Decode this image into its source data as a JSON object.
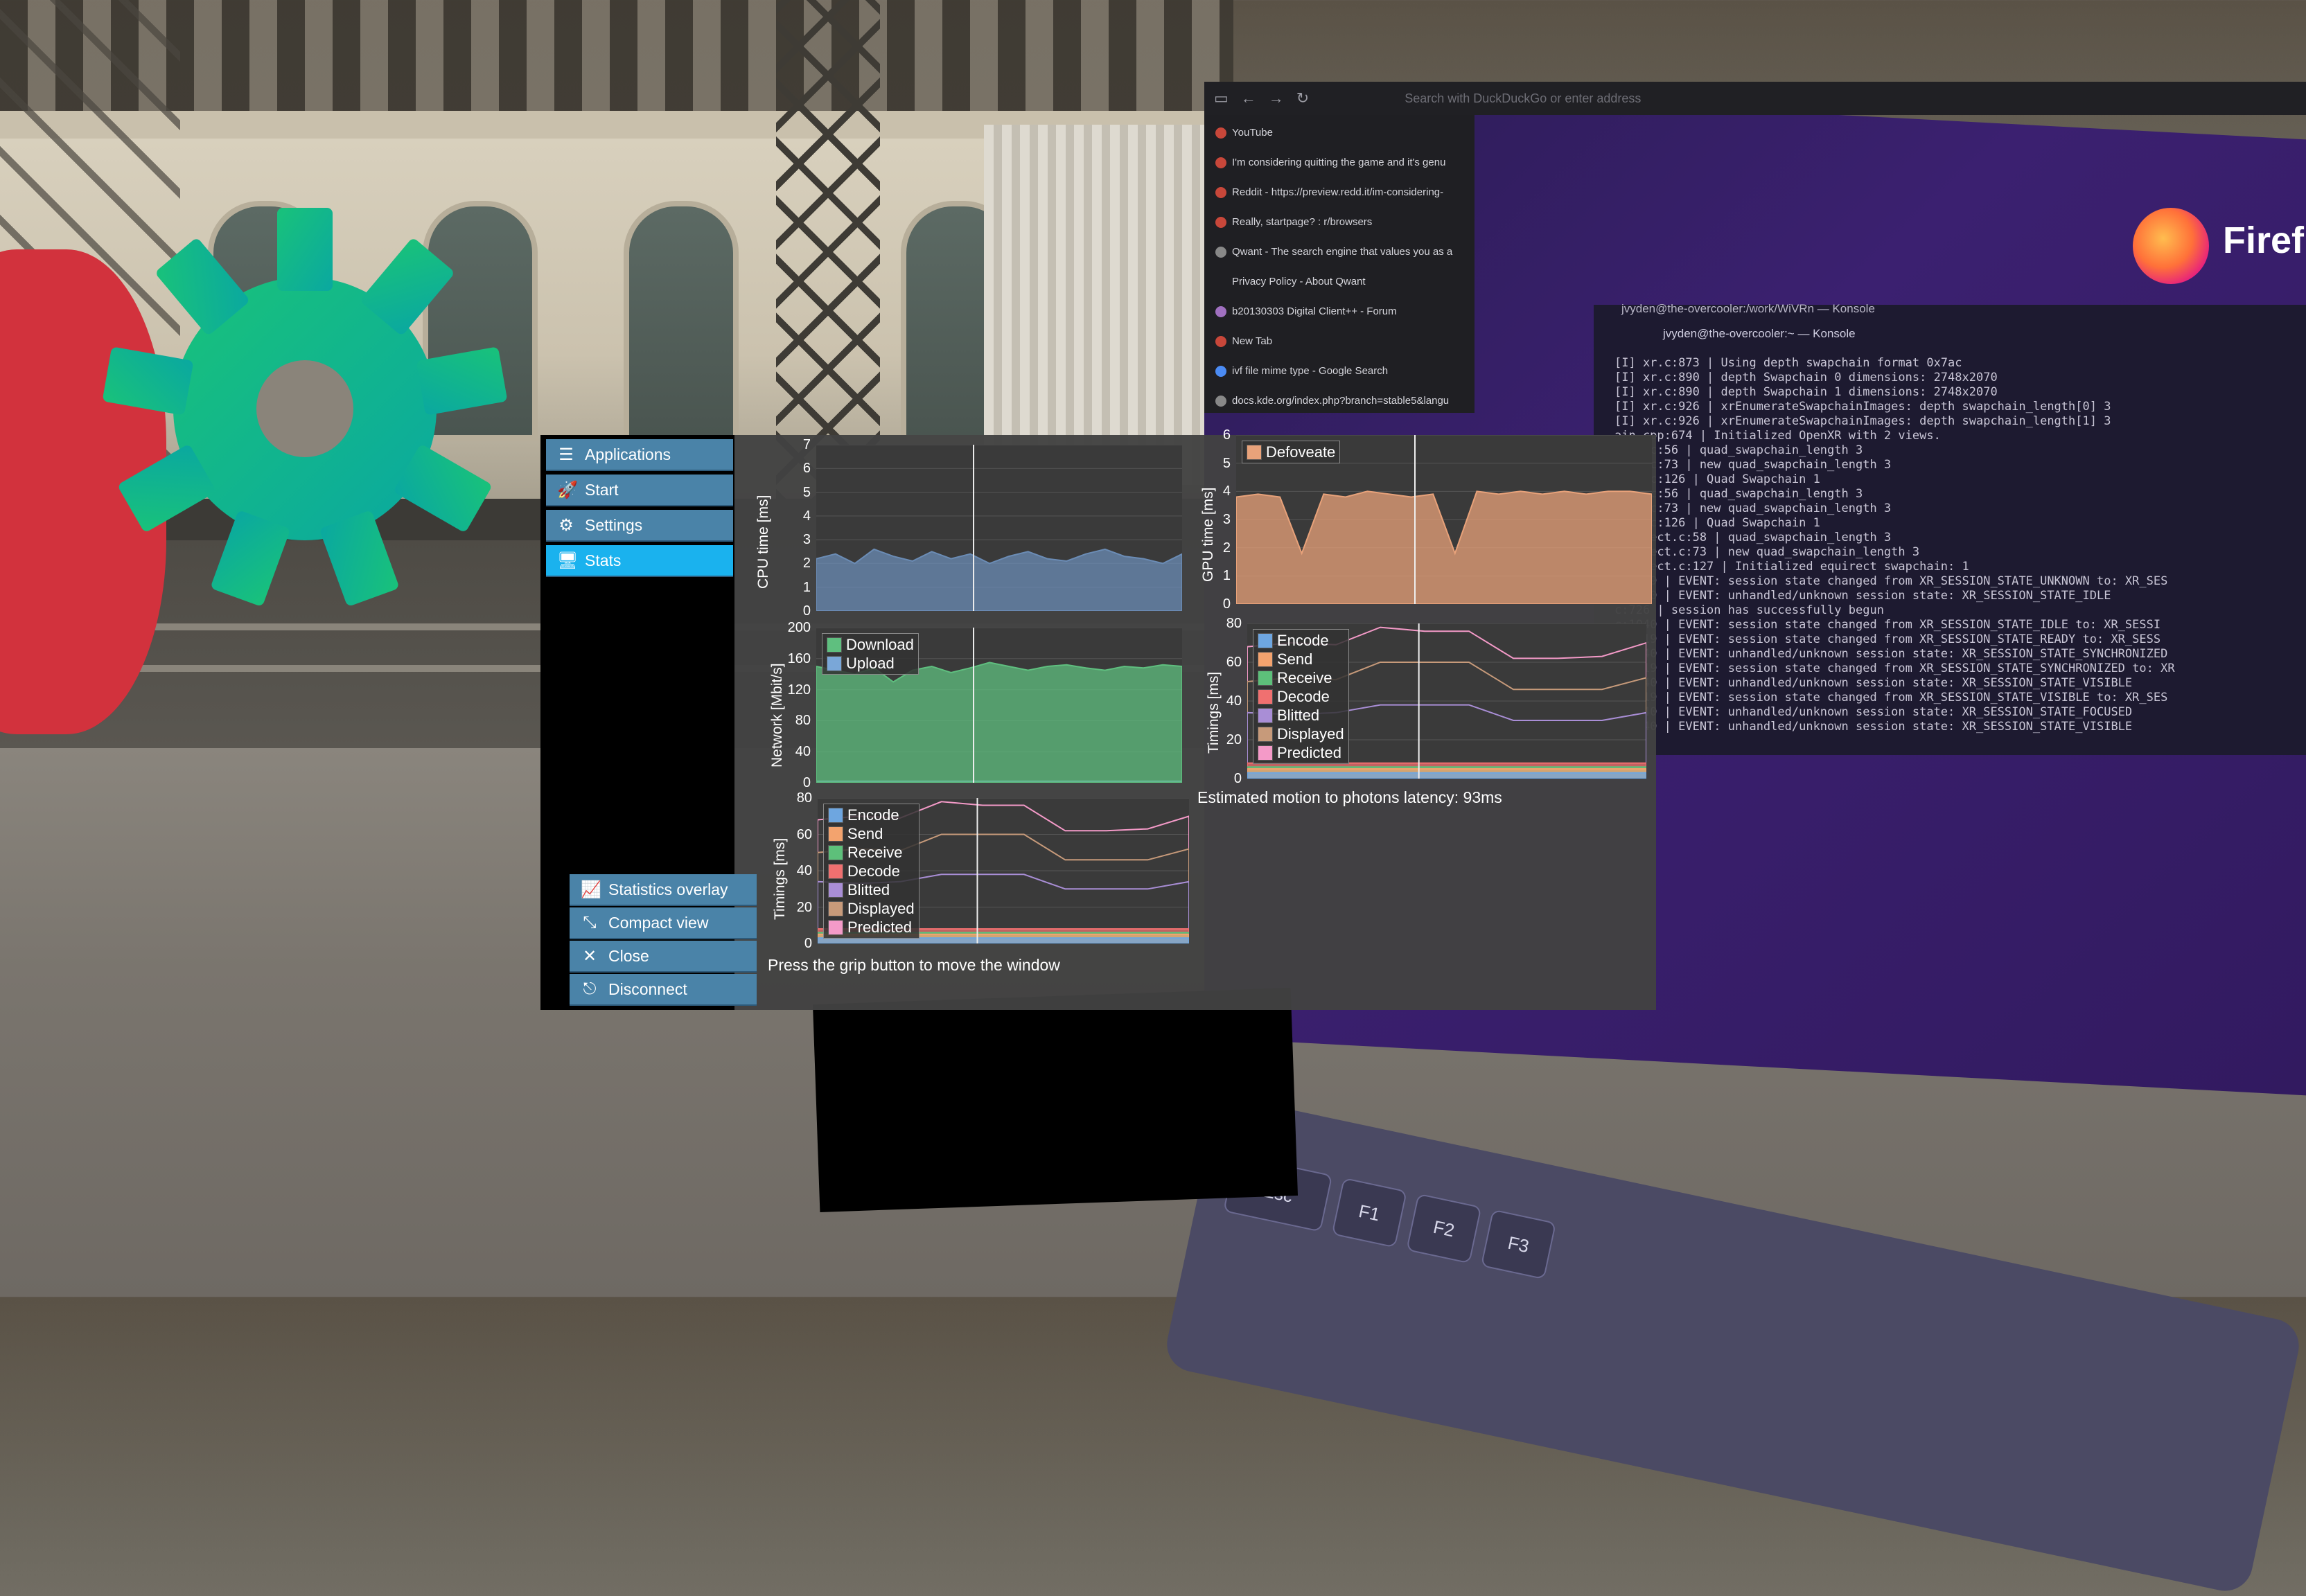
{
  "sidebar": {
    "items": [
      {
        "label": "Applications",
        "icon": "list-icon"
      },
      {
        "label": "Start",
        "icon": "rocket-icon"
      },
      {
        "label": "Settings",
        "icon": "gears-icon"
      },
      {
        "label": "Stats",
        "icon": "monitor-icon",
        "active": true
      }
    ],
    "bottom_items": [
      {
        "label": "Statistics overlay",
        "icon": "chart-line-icon"
      },
      {
        "label": "Compact view",
        "icon": "compress-icon"
      },
      {
        "label": "Close",
        "icon": "close-icon"
      },
      {
        "label": "Disconnect",
        "icon": "door-icon"
      }
    ]
  },
  "charts": {
    "cpu": {
      "ylabel": "CPU time [ms]",
      "ticks": [
        "7",
        "6",
        "5",
        "4",
        "3",
        "2",
        "1",
        "0"
      ]
    },
    "gpu": {
      "ylabel": "GPU time [ms]",
      "ticks": [
        "6",
        "5",
        "4",
        "3",
        "2",
        "1",
        "0"
      ],
      "legend": [
        "Defoveate"
      ]
    },
    "network": {
      "ylabel": "Network [Mbit/s]",
      "ticks": [
        "200",
        "160",
        "120",
        "80",
        "40",
        "0"
      ],
      "legend": [
        "Download",
        "Upload"
      ]
    },
    "timings_right": {
      "ylabel": "Timings [ms]",
      "ticks": [
        "80",
        "60",
        "40",
        "20",
        "0"
      ],
      "legend": [
        "Encode",
        "Send",
        "Receive",
        "Decode",
        "Blitted",
        "Displayed",
        "Predicted"
      ]
    },
    "timings_left": {
      "ylabel": "Timings [ms]",
      "ticks": [
        "80",
        "60",
        "40",
        "20",
        "0"
      ],
      "legend": [
        "Encode",
        "Send",
        "Receive",
        "Decode",
        "Blitted",
        "Displayed",
        "Predicted"
      ]
    }
  },
  "chart_data": [
    {
      "type": "area",
      "ylabel": "CPU time [ms]",
      "ylim": [
        0,
        7
      ],
      "series": [
        {
          "values": [
            2.2,
            2.4,
            2.0,
            2.6,
            2.3,
            2.1,
            2.5,
            2.2,
            2.4,
            2.0,
            2.3,
            2.5,
            2.2,
            2.1,
            2.4,
            2.6,
            2.3,
            2.2,
            2.0,
            2.4
          ]
        }
      ]
    },
    {
      "type": "area",
      "ylabel": "GPU time [ms]",
      "ylim": [
        0,
        6
      ],
      "series": [
        {
          "name": "Defoveate",
          "values": [
            3.8,
            3.9,
            3.8,
            1.8,
            3.9,
            3.8,
            4.0,
            3.9,
            3.8,
            3.9,
            1.8,
            4.0,
            3.9,
            4.0,
            3.9,
            4.0,
            3.9,
            4.0,
            4.0,
            3.9
          ]
        }
      ]
    },
    {
      "type": "area",
      "ylabel": "Network [Mbit/s]",
      "ylim": [
        0,
        200
      ],
      "series": [
        {
          "name": "Download",
          "values": [
            150,
            145,
            140,
            148,
            130,
            145,
            150,
            142,
            148,
            155,
            150,
            145,
            150,
            152,
            148,
            145,
            150,
            148,
            152,
            150
          ]
        },
        {
          "name": "Upload",
          "values": [
            2,
            2,
            2,
            2,
            2,
            2,
            2,
            2,
            2,
            2,
            2,
            2,
            2,
            2,
            2,
            2,
            2,
            2,
            2,
            2
          ]
        }
      ]
    },
    {
      "type": "area",
      "ylabel": "Timings [ms]",
      "ylim": [
        0,
        80
      ],
      "series": [
        {
          "name": "Encode",
          "values": [
            3,
            3,
            3,
            3,
            3,
            3,
            3,
            3,
            3,
            3
          ]
        },
        {
          "name": "Send",
          "values": [
            5,
            5,
            5,
            5,
            5,
            5,
            5,
            5,
            5,
            5
          ]
        },
        {
          "name": "Receive",
          "values": [
            6,
            6,
            6,
            6,
            6,
            6,
            6,
            6,
            6,
            6
          ]
        },
        {
          "name": "Decode",
          "values": [
            8,
            8,
            8,
            8,
            8,
            8,
            8,
            8,
            8,
            8
          ]
        },
        {
          "name": "Blitted",
          "values": [
            34,
            33,
            34,
            38,
            38,
            38,
            30,
            30,
            30,
            34
          ]
        },
        {
          "name": "Displayed",
          "values": [
            50,
            52,
            51,
            60,
            60,
            60,
            46,
            46,
            46,
            52
          ]
        },
        {
          "name": "Predicted",
          "values": [
            68,
            70,
            69,
            78,
            76,
            76,
            62,
            62,
            63,
            70
          ]
        }
      ]
    }
  ],
  "captions": {
    "latency": "Estimated motion to photons latency: 93ms",
    "grip": "Press the grip button to move the window"
  },
  "browser": {
    "urlbar": "Search with DuckDuckGo or enter address",
    "history": [
      "YouTube",
      "I'm considering quitting the game and it's genu",
      "Reddit - https://preview.redd.it/im-considering-",
      "Really, startpage? : r/browsers",
      "Qwant - The search engine that values you as a",
      "Privacy Policy - About Qwant",
      "b20130303 Digital Client++ - Forum",
      "New Tab",
      "ivf file mime type - Google Search",
      "docs.kde.org/index.php?branch=stable5&langu"
    ],
    "brand": "Firef"
  },
  "konsole": {
    "title": "jvyden@the-overcooler:/work/WiVRn — Konsole",
    "tab": "jvyden@the-overcooler:~ — Konsole",
    "lines": [
      "[I] xr.c:873 | Using depth swapchain format 0x7ac",
      "[I] xr.c:890 | depth Swapchain 0 dimensions: 2748x2070",
      "[I] xr.c:890 | depth Swapchain 1 dimensions: 2748x2070",
      "[I] xr.c:926 | xrEnumerateSwapchainImages: depth swapchain_length[0] 3",
      "[I] xr.c:926 | xrEnumerateSwapchainImages: depth swapchain_length[1] 3",
      "ain.cpp:674 | Initialized OpenXR with 2 views.",
      "quad.c:56 | quad_swapchain_length 3",
      "quad.c:73 | new quad_swapchain_length 3",
      "quad.c:126 | Quad Swapchain 1",
      "quad.c:56 | quad_swapchain_length 3",
      "quad.c:73 | new quad_swapchain_length 3",
      "quad.c:126 | Quad Swapchain 1",
      "equirect.c:58 | quad_swapchain_length 3",
      "equirect.c:73 | new quad_swapchain_length 3",
      "equirect.c:127 | Initialized equirect swapchain: 1",
      "c:1019 | EVENT: session state changed from XR_SESSION_STATE_UNKNOWN to: XR_SES",
      "c:1040 | EVENT: unhandled/unknown session state: XR_SESSION_STATE_IDLE",
      "c:726 | session has successfully begun",
      "c:1040 | EVENT: session state changed from XR_SESSION_STATE_IDLE to: XR_SESSI",
      "c:1019 | EVENT: session state changed from XR_SESSION_STATE_READY to: XR_SESS",
      "c:1040 | EVENT: unhandled/unknown session state: XR_SESSION_STATE_SYNCHRONIZED",
      "c:1019 | EVENT: session state changed from XR_SESSION_STATE_SYNCHRONIZED to: XR",
      "c:1040 | EVENT: unhandled/unknown session state: XR_SESSION_STATE_VISIBLE",
      "c:1019 | EVENT: session state changed from XR_SESSION_STATE_VISIBLE to: XR_SES",
      "c:1040 | EVENT: unhandled/unknown session state: XR_SESSION_STATE_FOCUSED",
      "c:1040 | EVENT: unhandled/unknown session state: XR_SESSION_STATE_VISIBLE"
    ]
  },
  "keyboard": {
    "keys": [
      "Esc",
      "F1",
      "F2",
      "F3"
    ]
  },
  "colors": {
    "accent": "#1ab2ee",
    "sidebar_button": "#4a83a8",
    "cpu": "#6b8cb5",
    "gpu": "#e8a27a",
    "download": "#5fbf7f",
    "upload": "#7aa7d8",
    "encode": "#6ea6e0",
    "send": "#f3a36e",
    "receive": "#5dc07a",
    "decode": "#f07070",
    "blitted": "#a98ed6",
    "displayed": "#c79a7a",
    "predicted": "#f49ac8"
  }
}
